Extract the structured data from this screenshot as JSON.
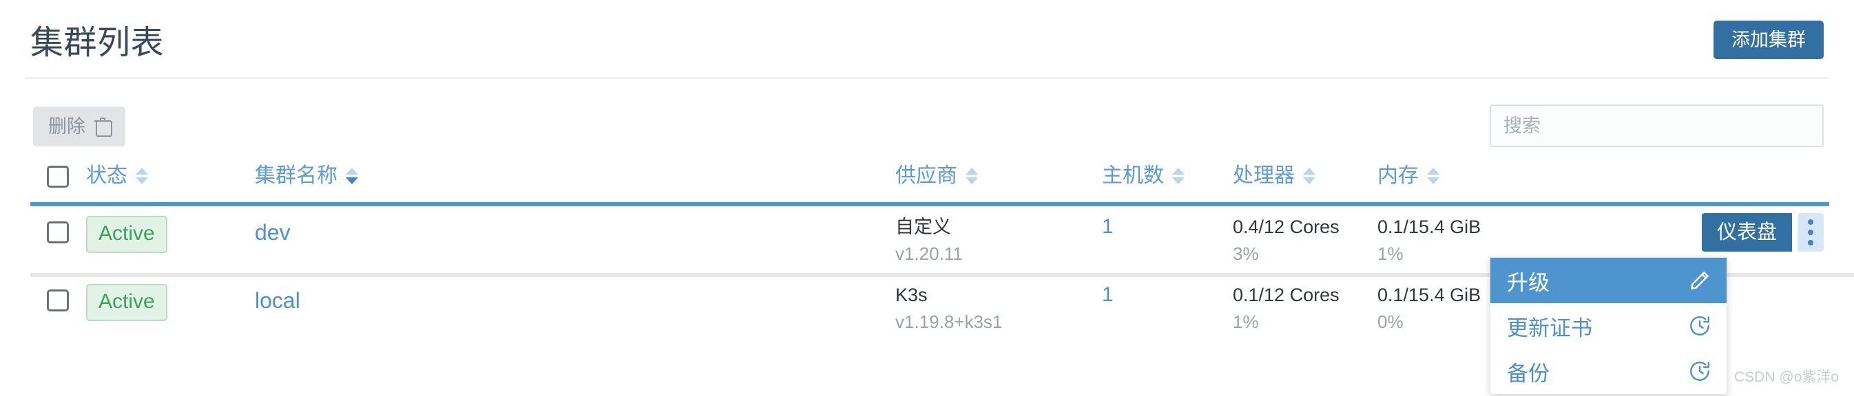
{
  "header": {
    "title": "集群列表",
    "add_cluster_label": "添加集群"
  },
  "toolbar": {
    "delete_label": "删除",
    "delete_icon": "trash-icon",
    "search_placeholder": "搜索",
    "search_value": ""
  },
  "table": {
    "columns": [
      {
        "key": "status",
        "label": "状态",
        "sort": "none"
      },
      {
        "key": "name",
        "label": "集群名称",
        "sort": "desc"
      },
      {
        "key": "provider",
        "label": "供应商",
        "sort": "none"
      },
      {
        "key": "hosts",
        "label": "主机数",
        "sort": "none"
      },
      {
        "key": "cpu",
        "label": "处理器",
        "sort": "none"
      },
      {
        "key": "memory",
        "label": "内存",
        "sort": "none"
      }
    ],
    "rows": [
      {
        "checked": false,
        "status": "Active",
        "name": "dev",
        "provider": "自定义",
        "provider_version": "v1.20.11",
        "hosts": "1",
        "cpu": "0.4/12 Cores",
        "cpu_percent": "3%",
        "memory": "0.1/15.4 GiB",
        "memory_percent": "1%",
        "dashboard_label": "仪表盘"
      },
      {
        "checked": false,
        "status": "Active",
        "name": "local",
        "provider": "K3s",
        "provider_version": "v1.19.8+k3s1",
        "hosts": "1",
        "cpu": "0.1/12 Cores",
        "cpu_percent": "1%",
        "memory": "0.1/15.4 GiB",
        "memory_percent": "0%"
      }
    ]
  },
  "dropdown": {
    "items": [
      {
        "label": "升级",
        "icon": "pencil-icon",
        "selected": true
      },
      {
        "label": "更新证书",
        "icon": "clock-rotate-icon",
        "selected": false
      },
      {
        "label": "备份",
        "icon": "clock-rotate-icon",
        "selected": false
      }
    ]
  },
  "watermark": "CSDN @o紫洋o",
  "colors": {
    "accent": "#3270a1",
    "link": "#4e8fd1",
    "header_link": "#5a9bd8",
    "status_green": "#3ba25a",
    "status_green_bg": "#e3f2e6",
    "title": "#37495b",
    "selected_row": "#4e95d0"
  }
}
